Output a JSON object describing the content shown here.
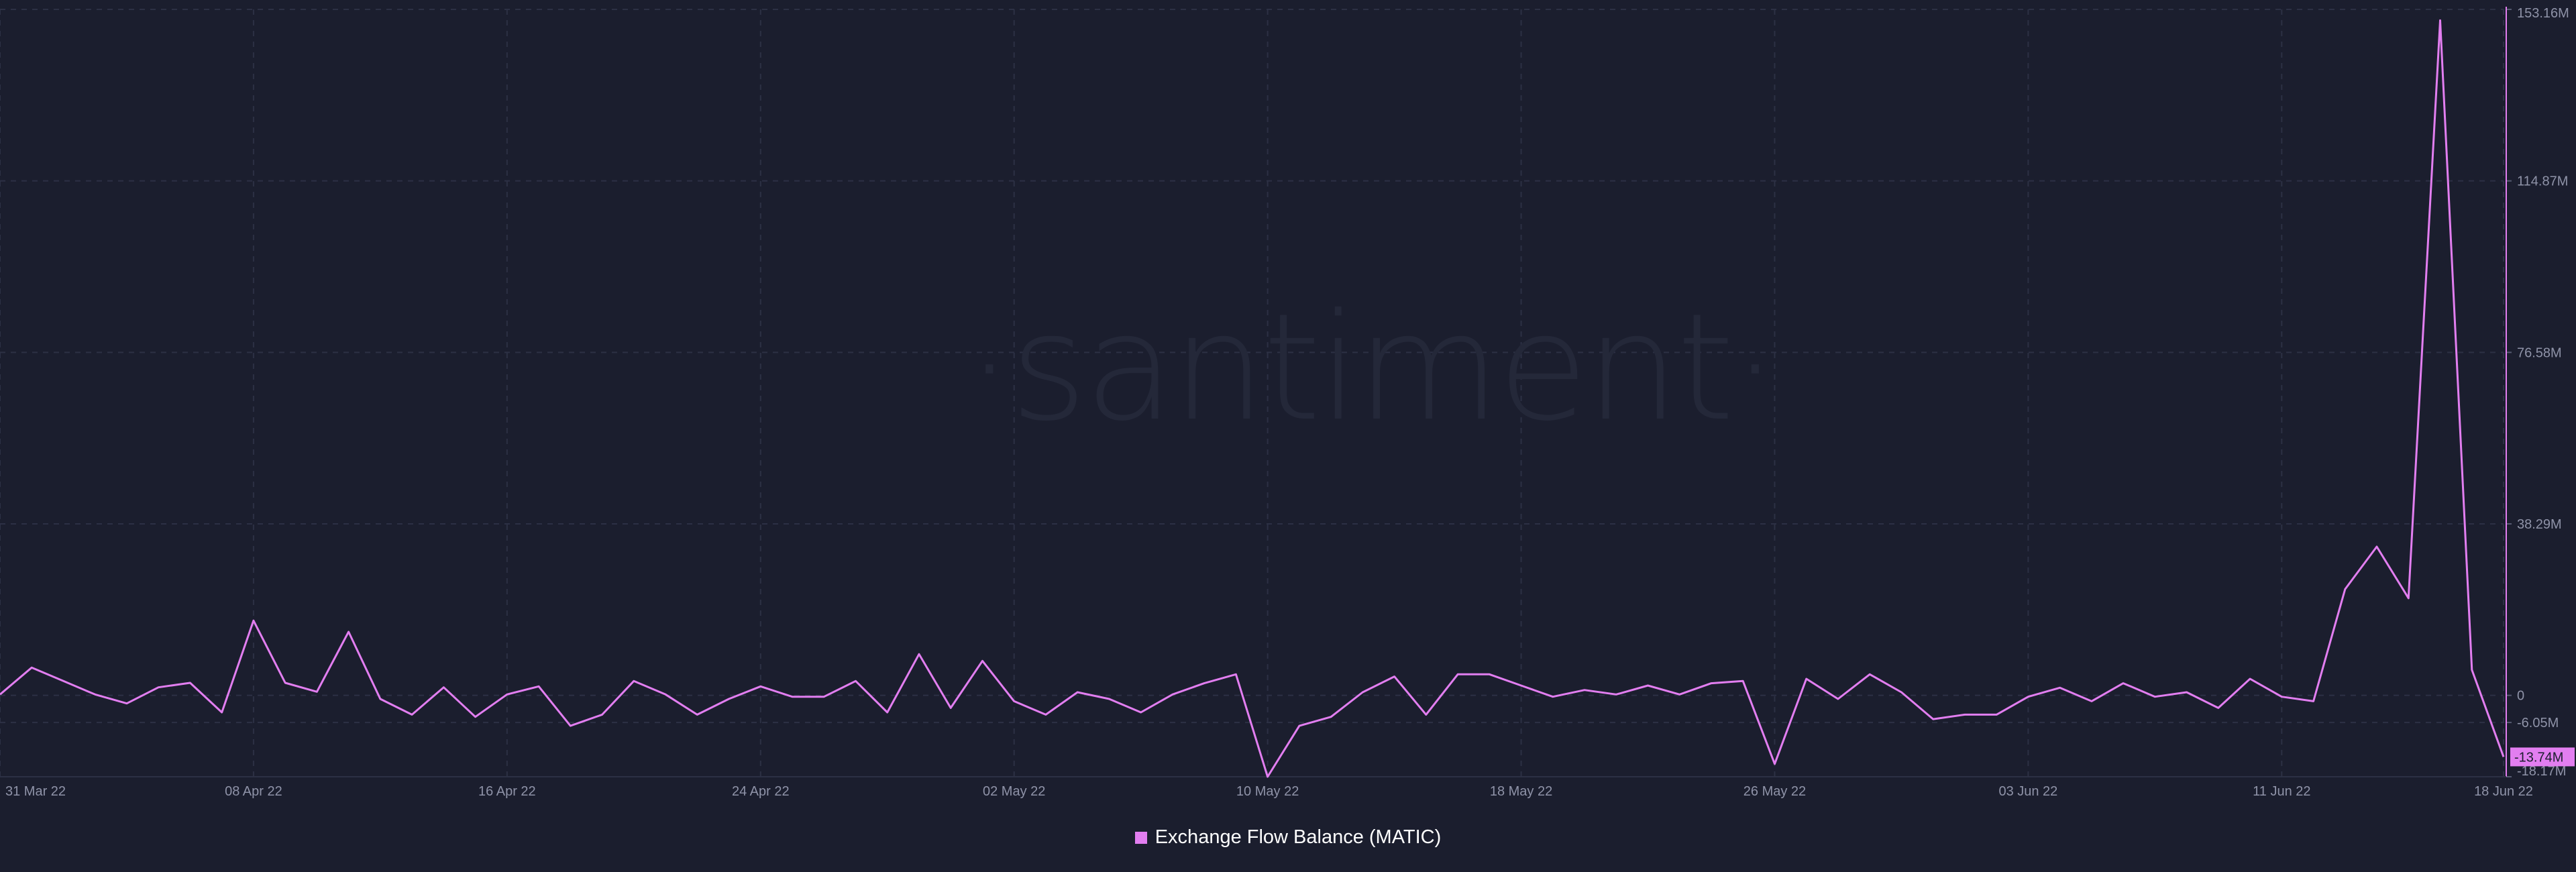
{
  "watermark": "·santiment·",
  "legend": {
    "label": "Exchange Flow Balance (MATIC)",
    "color": "#e27ef0"
  },
  "colors": {
    "background": "#1b1e2e",
    "line": "#e27ef0",
    "grid": "#2c3044",
    "tick_text": "#8f93a8"
  },
  "chart_data": {
    "type": "line",
    "title": "",
    "xlabel": "",
    "ylabel": "",
    "x_ticks": [
      "31 Mar 22",
      "08 Apr 22",
      "16 Apr 22",
      "24 Apr 22",
      "02 May 22",
      "10 May 22",
      "18 May 22",
      "26 May 22",
      "03 Jun 22",
      "11 Jun 22",
      "18 Jun 22"
    ],
    "y_ticks": [
      "153.16M",
      "114.87M",
      "76.58M",
      "38.29M",
      "0",
      "-6.05M",
      "-18.17M"
    ],
    "ylim": [
      -18.17,
      153.16
    ],
    "y_unit": "M",
    "grid": true,
    "legend_position": "bottom-center",
    "last_value_label": "-13.74M",
    "series": [
      {
        "name": "Exchange Flow Balance (MATIC)",
        "x_start": "31 Mar 22",
        "x_step_days": 1,
        "values": [
          0.2,
          6.2,
          3.2,
          0.2,
          -1.8,
          1.8,
          2.8,
          -3.8,
          16.7,
          2.8,
          0.8,
          14.2,
          -0.8,
          -4.3,
          1.8,
          -4.8,
          0.2,
          2.0,
          -6.8,
          -4.3,
          3.2,
          0.2,
          -4.3,
          -0.8,
          2.0,
          -0.3,
          -0.3,
          3.2,
          -3.8,
          9.2,
          -2.8,
          7.7,
          -1.3,
          -4.3,
          0.7,
          -0.8,
          -3.8,
          0.2,
          2.7,
          4.7,
          -18.17,
          -6.8,
          -4.8,
          0.7,
          4.2,
          -4.3,
          4.7,
          4.7,
          2.2,
          -0.3,
          1.2,
          0.2,
          2.2,
          0.2,
          2.7,
          3.2,
          -15.3,
          3.7,
          -0.8,
          4.7,
          0.7,
          -5.3,
          -4.3,
          -4.3,
          -0.3,
          1.7,
          -1.3,
          2.7,
          -0.3,
          0.7,
          -2.8,
          3.7,
          -0.3,
          -1.3,
          23.7,
          33.2,
          21.7,
          150.7,
          5.7,
          -13.74
        ]
      }
    ]
  }
}
